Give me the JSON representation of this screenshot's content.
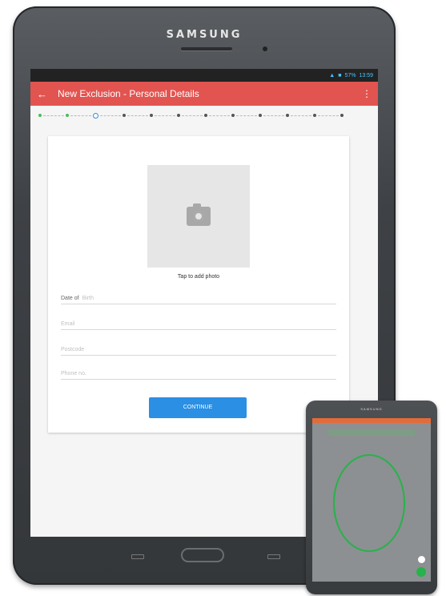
{
  "device_brand": "SAMSUNG",
  "status_bar": {
    "battery": "57%",
    "time": "13:59"
  },
  "app_bar": {
    "back_icon": "arrow-left-icon",
    "title": "New Exclusion - Personal Details",
    "menu_icon": "more-vertical-icon"
  },
  "stepper": {
    "steps": [
      {
        "state": "done"
      },
      {
        "state": "done"
      },
      {
        "state": "current"
      },
      {
        "state": "pending"
      },
      {
        "state": "pending"
      },
      {
        "state": "pending"
      },
      {
        "state": "pending"
      },
      {
        "state": "pending"
      },
      {
        "state": "pending"
      },
      {
        "state": "pending"
      },
      {
        "state": "pending"
      },
      {
        "state": "pending"
      }
    ]
  },
  "form": {
    "photo_icon": "camera-icon",
    "photo_label": "Tap to add photo",
    "fields": [
      {
        "lead": "Date of",
        "placeholder": "Birth"
      },
      {
        "lead": "",
        "placeholder": "Email"
      },
      {
        "lead": "",
        "placeholder": "Postcode"
      },
      {
        "lead": "",
        "placeholder": "Phone no."
      }
    ],
    "continue_label": "CONTINUE"
  },
  "colors": {
    "app_bar": "#e25450",
    "accent": "#2b8fe3",
    "step_done": "#4cbb5b",
    "face_frame": "#27b24a"
  }
}
